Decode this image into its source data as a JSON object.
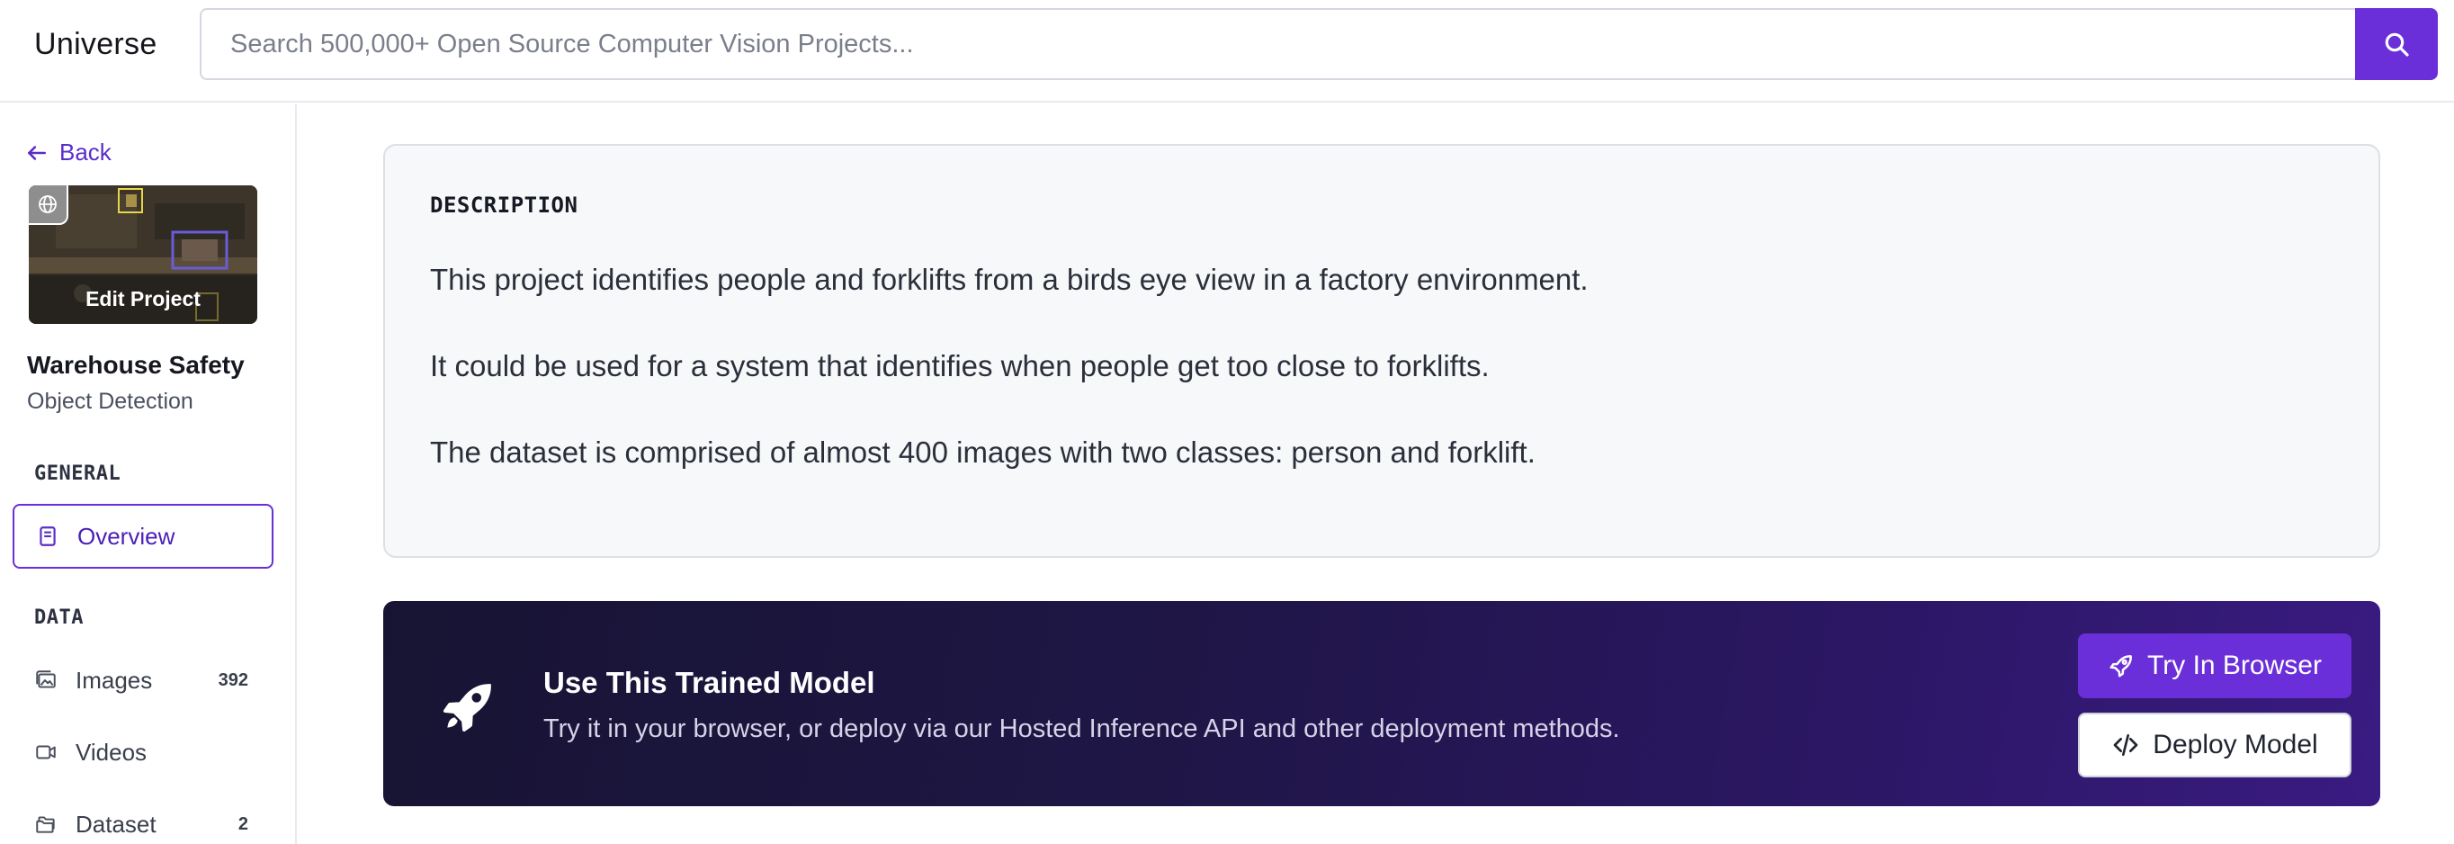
{
  "header": {
    "logo": "Universe",
    "search_placeholder": "Search 500,000+ Open Source Computer Vision Projects...",
    "search_icon": "search-icon"
  },
  "sidebar": {
    "back_label": "Back",
    "thumbnail_label": "Edit Project",
    "project_title": "Warehouse Safety",
    "project_type": "Object Detection",
    "sections": [
      {
        "label": "GENERAL",
        "items": [
          {
            "label": "Overview",
            "icon": "book-icon",
            "active": true
          }
        ]
      },
      {
        "label": "DATA",
        "items": [
          {
            "label": "Images",
            "icon": "image-icon",
            "count": "392"
          },
          {
            "label": "Videos",
            "icon": "video-icon"
          },
          {
            "label": "Dataset",
            "icon": "folder-icon",
            "count": "2"
          }
        ]
      }
    ]
  },
  "description": {
    "heading": "DESCRIPTION",
    "paragraphs": [
      "This project identifies people and forklifts from a birds eye view in a factory environment.",
      "It could be used for a system that identifies when people get too close to forklifts.",
      "The dataset is comprised of almost 400 images with two classes: person and forklift."
    ]
  },
  "model_cta": {
    "title": "Use This Trained Model",
    "subtitle": "Try it in your browser, or deploy via our Hosted Inference API and other deployment methods.",
    "try_label": "Try In Browser",
    "deploy_label": "Deploy Model"
  },
  "colors": {
    "accent": "#6a2fd8",
    "cta_bg_start": "#171433",
    "cta_bg_end": "#3a1b82"
  }
}
